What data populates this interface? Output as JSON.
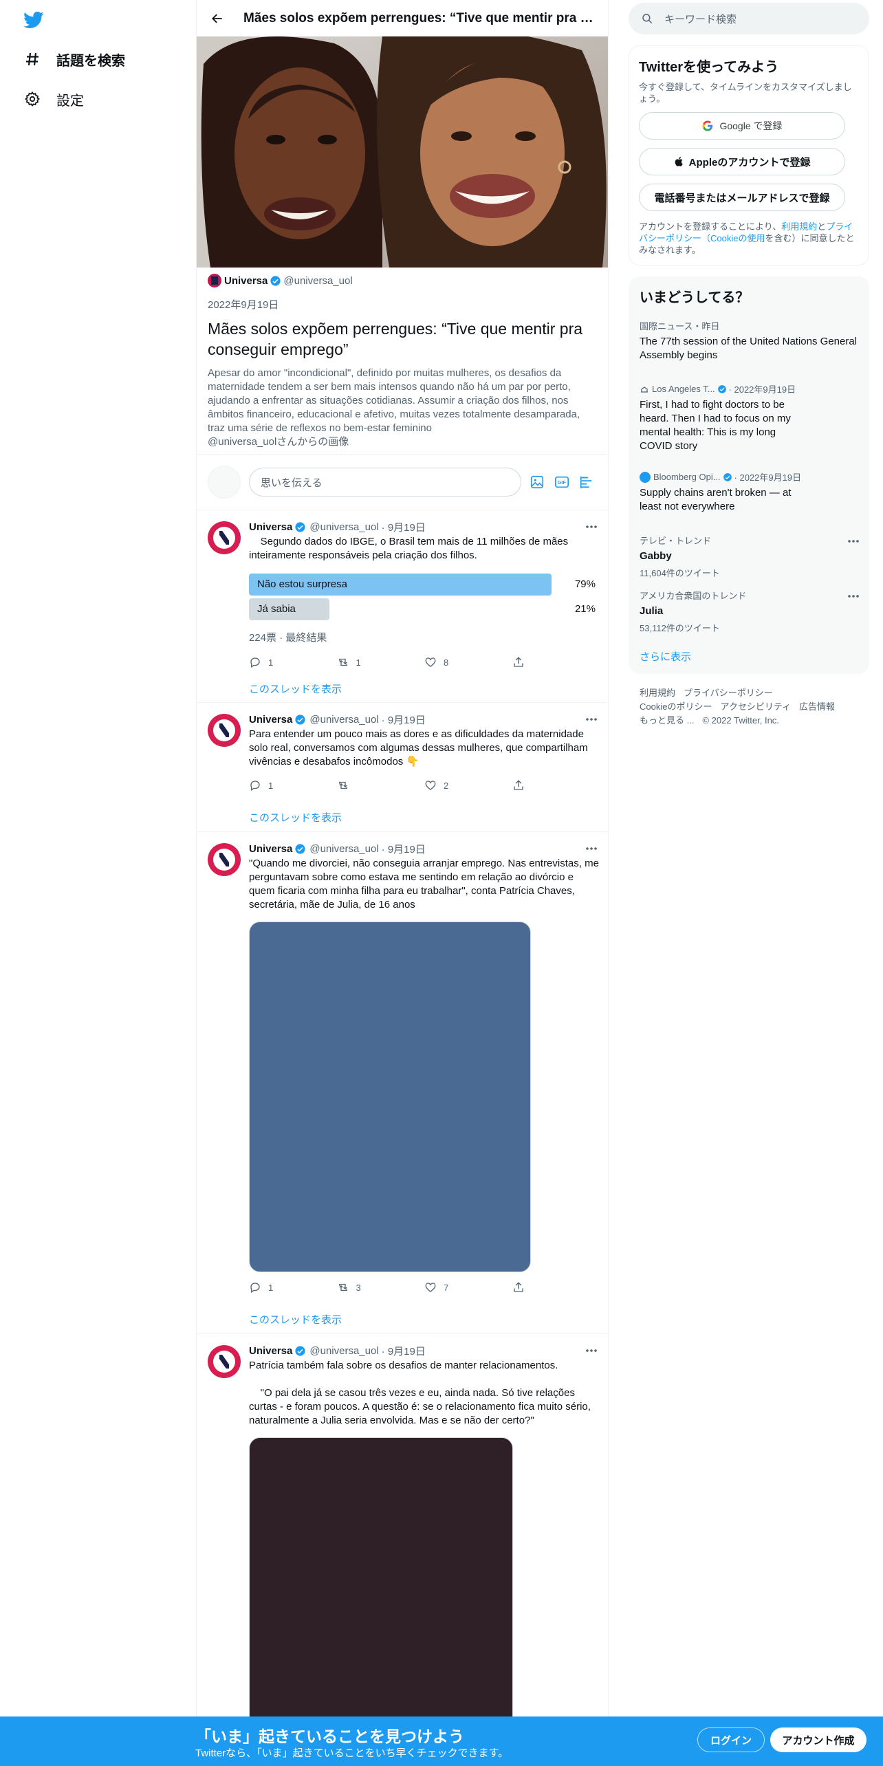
{
  "nav": {
    "items": [
      {
        "label": "話題を検索",
        "icon": "hashtag-icon"
      },
      {
        "label": "設定",
        "icon": "gear-icon"
      }
    ]
  },
  "header": {
    "title": "Mães solos expõem perrengues: “Tive que mentir pra conseguir emprego”"
  },
  "article": {
    "author_name": "Universa",
    "author_handle": "@universa_uol",
    "date": "2022年9月19日",
    "title": "Mães solos expõem perrengues: “Tive que mentir pra conseguir emprego”",
    "description": "Apesar do amor \"incondicional\", definido por muitas mulheres, os desafios da maternidade tendem a ser bem mais intensos quando não há um par por perto, ajudando a enfrentar as situações cotidianas. Assumir a criação dos filhos, nos âmbitos financeiro, educacional e afetivo, muitas vezes totalmente desamparada, traz uma série de reflexos no bem-estar feminino",
    "image_credit": "@universa_uolさんからの画像"
  },
  "compose": {
    "placeholder": "思いを伝える"
  },
  "tweets": [
    {
      "name": "Universa",
      "handle": "@universa_uol",
      "date": "· 9月19日",
      "text": "    Segundo dados do IBGE, o Brasil tem mais de 11 milhões de mães inteiramente responsáveis pela criação dos filhos.",
      "poll": {
        "options": [
          {
            "label": "Não estou surpresa",
            "pct": "79%",
            "value": 79,
            "color": "#7cc3f4"
          },
          {
            "label": "Já sabia",
            "pct": "21%",
            "value": 21,
            "color": "#cfd9de"
          }
        ],
        "meta": "224票 · 最終結果"
      },
      "replies": "1",
      "retweets": "1",
      "likes": "8",
      "thread": "このスレッドを表示"
    },
    {
      "name": "Universa",
      "handle": "@universa_uol",
      "date": "· 9月19日",
      "text": "Para entender um pouco mais as dores e as dificuldades da maternidade solo real, conversamos com algumas dessas mulheres, que compartilham vivências e desabafos incômodos 👇",
      "replies": "1",
      "retweets": "",
      "likes": "2",
      "thread": "このスレッドを表示"
    },
    {
      "name": "Universa",
      "handle": "@universa_uol",
      "date": "· 9月19日",
      "text": "\"Quando me divorciei, não conseguia arranjar emprego. Nas entrevistas, me perguntavam sobre como estava me sentindo em relação ao divórcio e quem ficaria com minha filha para eu trabalhar\", conta Patrícia Chaves, secretária, mãe de Julia, de 16 anos",
      "media_color": "#4a6a94",
      "replies": "1",
      "retweets": "3",
      "likes": "7",
      "thread": "このスレッドを表示"
    },
    {
      "name": "Universa",
      "handle": "@universa_uol",
      "date": "· 9月19日",
      "text": "Patrícia também fala sobre os desafios de manter relacionamentos.\n\n    \"O pai dela já se casou três vezes e eu, ainda nada. Só tive relações curtas - e foram poucos. A questão é: se o relacionamento fica muito sério, naturalmente a Julia seria envolvida. Mas e se não der certo?\"",
      "media_color": "#2e2026"
    }
  ],
  "sidebar": {
    "search_placeholder": "キーワード検索",
    "signup": {
      "title": "Twitterを使ってみよう",
      "subtitle": "今すぐ登録して、タイムラインをカスタマイズしましょう。",
      "google": "Google で登録",
      "apple": "Appleのアカウントで登録",
      "phone": "電話番号またはメールアドレスで登録",
      "terms_pre": "アカウントを登録することにより、",
      "terms_link1": "利用規約",
      "terms_mid": "と",
      "terms_link2": "プライバシーポリシー（Cookieの使用",
      "terms_post": "を含む）に同意したとみなされます。"
    },
    "trends": {
      "title": "いまどうしてる？",
      "items": [
        {
          "context": "国際ニュース・昨日",
          "title": "The 77th session of the United Nations General Assembly begins"
        },
        {
          "source": "Los Angeles T...",
          "date": "· 2022年9月19日",
          "title": "First, I had to fight doctors to be heard. Then I had to focus on my mental health: This is my long COVID story"
        },
        {
          "source": "Bloomberg Opi...",
          "date": "· 2022年9月19日",
          "title": "Supply chains aren't broken — at least not everywhere"
        },
        {
          "context": "テレビ・トレンド",
          "title": "Gabby",
          "count": "11,604件のツイート"
        },
        {
          "context": "アメリカ合衆国のトレンド",
          "title": "Julia",
          "count": "53,112件のツイート"
        }
      ],
      "show_more": "さらに表示"
    },
    "footer": [
      "利用規約",
      "プライバシーポリシー",
      "Cookieのポリシー",
      "アクセシビリティ",
      "広告情報",
      "もっと見る ...",
      "© 2022 Twitter, Inc."
    ]
  },
  "bottom_bar": {
    "title": "「いま」起きていることを見つけよう",
    "subtitle": "Twitterなら、「いま」起きていることをいち早くチェックできます。",
    "login": "ログイン",
    "signup": "アカウント作成"
  },
  "colors": {
    "accent": "#1d9bf0",
    "bottom_bar": "#1d9bf0"
  }
}
